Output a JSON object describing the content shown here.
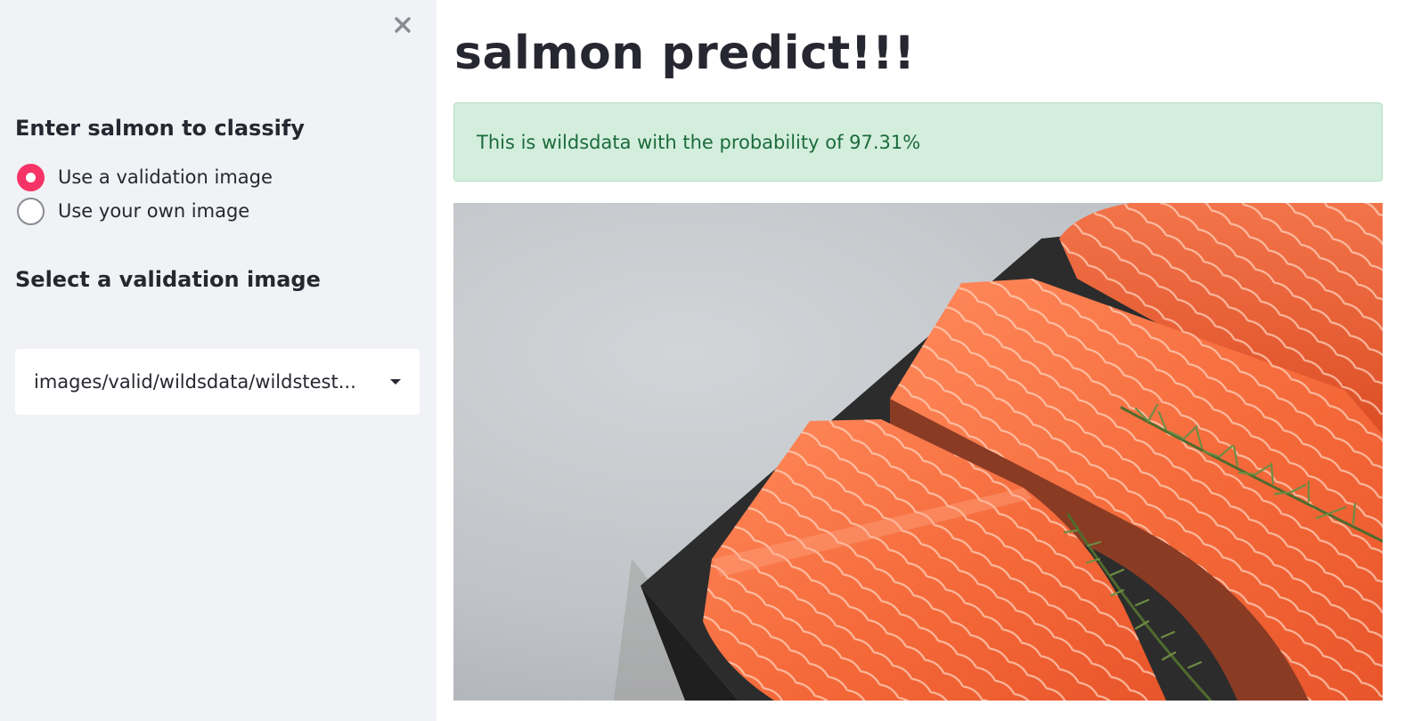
{
  "sidebar": {
    "close_icon": "close-icon",
    "heading_classify": "Enter salmon to classify",
    "radio_options": [
      {
        "label": "Use a validation image",
        "selected": true
      },
      {
        "label": "Use your own image",
        "selected": false
      }
    ],
    "heading_select": "Select a validation image",
    "select_value": "images/valid/wildsdata/wildstest...",
    "select_icon": "chevron-down-icon"
  },
  "main": {
    "title": "salmon predict!!!",
    "alert_text": "This is wildsdata with the probability of 97.31%"
  },
  "colors": {
    "accent": "#f63366",
    "sidebar_bg": "#f0f2f6",
    "success_bg": "#d4eede",
    "success_text": "#1b6b3a",
    "text": "#262730"
  }
}
